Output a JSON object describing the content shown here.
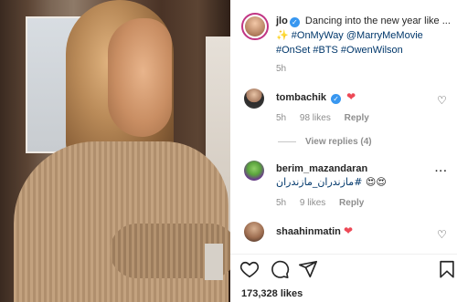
{
  "post": {
    "author": "jlo",
    "caption_text": "Dancing into the new year like ...",
    "hashtags_line1": "#OnMyWay @MarryMeMovie",
    "hashtags_line2": "#OnSet #BTS #OwenWilson",
    "time": "5h",
    "likes": "173,328 likes"
  },
  "comments": [
    {
      "username": "tombachik",
      "text": "❤",
      "time": "5h",
      "likes": "98 likes",
      "reply": "Reply",
      "view_replies": "View replies (4)"
    },
    {
      "username": "berim_mazandaran",
      "text": "مازندران_مازندران#",
      "emojis": "😍😍",
      "time": "5h",
      "likes": "9 likes",
      "reply": "Reply"
    },
    {
      "username": "shaahinmatin",
      "text": "❤"
    }
  ],
  "icons": {
    "verified": "verified-check-icon",
    "heart": "heart-outline-icon",
    "comment": "comment-bubble-icon",
    "share": "paper-plane-icon",
    "save": "bookmark-icon",
    "more": "more-dots-icon"
  },
  "colors": {
    "link": "#00376b",
    "verified": "#3897f0",
    "heart_red": "#ed4956",
    "muted": "#8e8e8e"
  }
}
